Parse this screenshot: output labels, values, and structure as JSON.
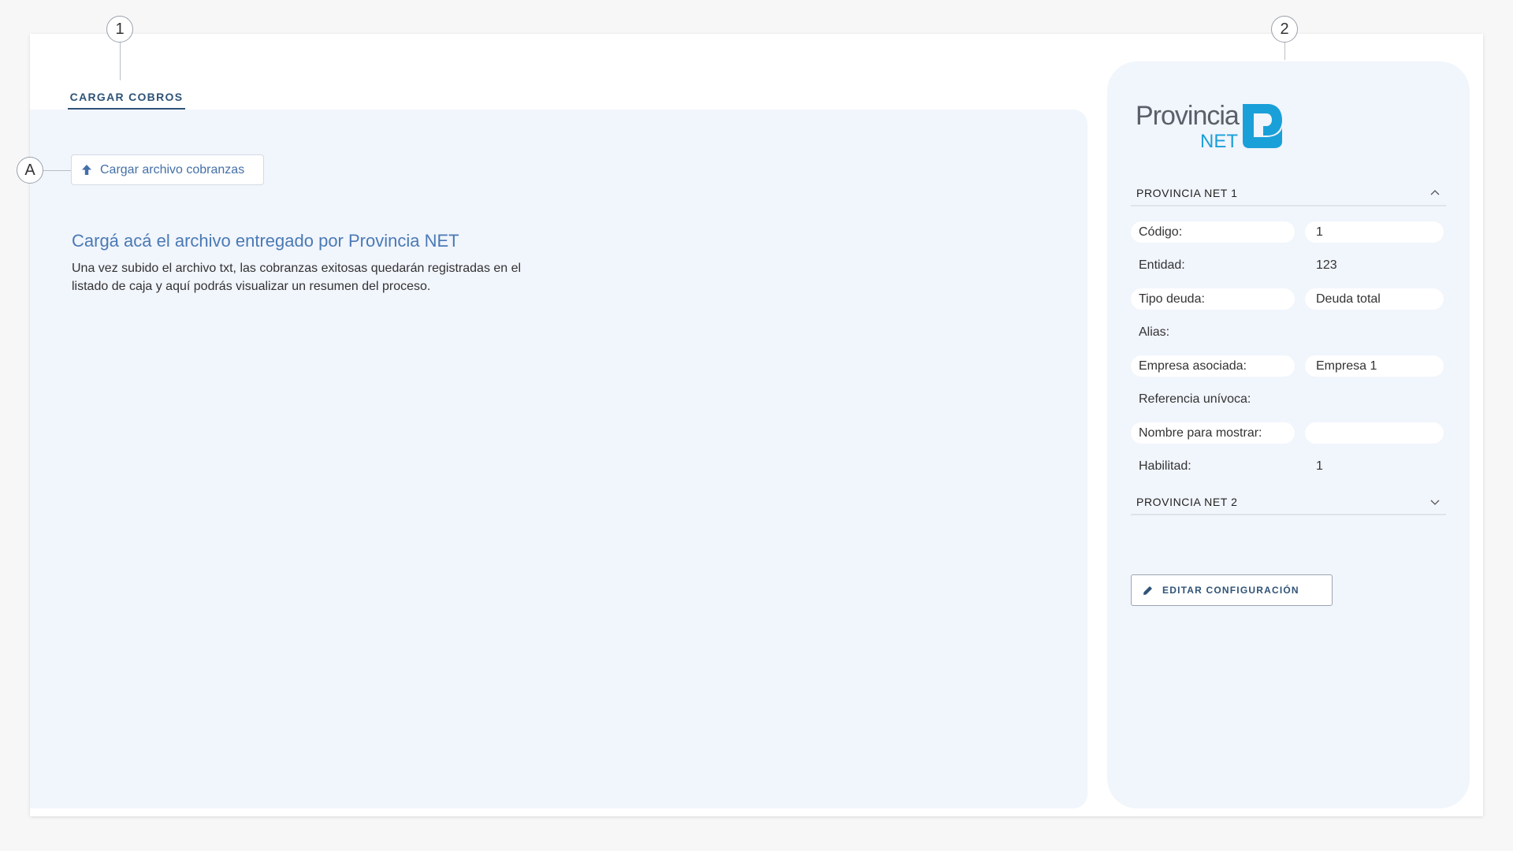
{
  "callouts": {
    "one": "1",
    "two": "2",
    "a": "A"
  },
  "tab": {
    "label": "CARGAR COBROS"
  },
  "upload": {
    "label": "Cargar archivo cobranzas",
    "icon": "upload-arrow-icon"
  },
  "intro": {
    "heading": "Cargá acá el archivo entregado por Provincia NET",
    "body": "Una vez subido el archivo txt, las cobranzas exitosas quedarán registradas en el listado de caja y aquí podrás visualizar un resumen del proceso."
  },
  "logo": {
    "word": "Provincia",
    "sub": "NET",
    "brand_color": "#1aa0d8"
  },
  "sections": [
    {
      "title": "PROVINCIA NET 1",
      "expanded": true,
      "icon": "chevron-up-icon"
    },
    {
      "title": "PROVINCIA NET 2",
      "expanded": false,
      "icon": "chevron-down-icon"
    }
  ],
  "fields": [
    {
      "label": "Código:",
      "value": "1"
    },
    {
      "label": "Entidad:",
      "value": "123"
    },
    {
      "label": "Tipo deuda:",
      "value": "Deuda total"
    },
    {
      "label": "Alias:",
      "value": ""
    },
    {
      "label": "Empresa asociada:",
      "value": "Empresa 1"
    },
    {
      "label": "Referencia unívoca:",
      "value": ""
    },
    {
      "label": "Nombre para mostrar:",
      "value": ""
    },
    {
      "label": "Habilitad:",
      "value": "1"
    }
  ],
  "edit": {
    "label": "EDITAR CONFIGURACIÓN",
    "icon": "pencil-icon"
  },
  "colors": {
    "accent": "#2f5377",
    "link": "#4a7ab5",
    "panel_bg": "#f1f5fc"
  }
}
